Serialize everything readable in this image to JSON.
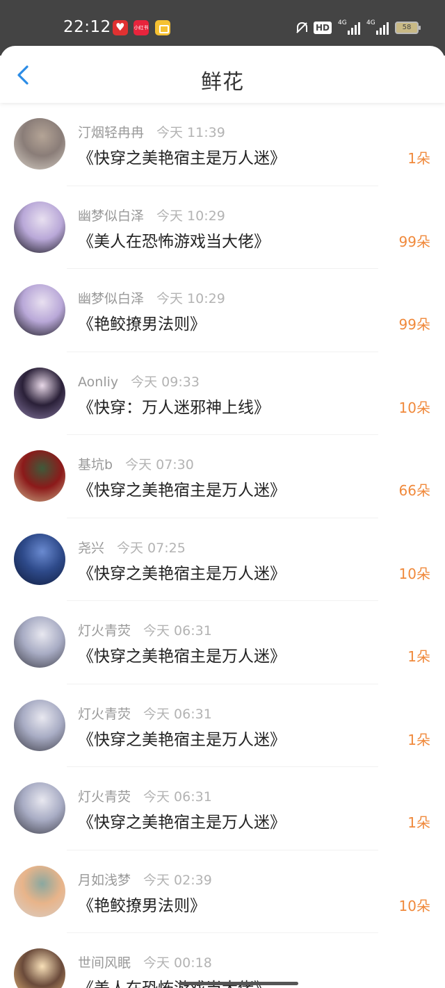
{
  "status_bar": {
    "time": "22:12",
    "app_icons": [
      "heart-app-icon",
      "xiaohongshu-icon",
      "coupon-app-icon"
    ],
    "xhs_label": "小红书",
    "hd_label": "HD",
    "network_labels": [
      "4G",
      "4G"
    ],
    "battery_level": "58"
  },
  "header": {
    "back_icon": "chevron-left-icon",
    "title": "鲜花",
    "accent_color": "#2b8ce6"
  },
  "colors": {
    "count": "#f0893b",
    "name": "#999999",
    "title": "#222222"
  },
  "flowers": [
    {
      "name": "汀烟轻冉冉",
      "time": "今天 11:39",
      "book": "《快穿之美艳宿主是万人迷》",
      "count": "1朵",
      "avatar_colors": [
        "#d9d2c8",
        "#8a7d78",
        "#b4a496"
      ]
    },
    {
      "name": "幽梦似白泽",
      "time": "今天 10:29",
      "book": "《美人在恐怖游戏当大佬》",
      "count": "99朵",
      "avatar_colors": [
        "#0f0f14",
        "#b9a8d8",
        "#e8e0f0"
      ]
    },
    {
      "name": "幽梦似白泽",
      "time": "今天 10:29",
      "book": "《艳鲛撩男法则》",
      "count": "99朵",
      "avatar_colors": [
        "#0f0f14",
        "#b9a8d8",
        "#e8e0f0"
      ]
    },
    {
      "name": "Aonliy",
      "time": "今天 09:33",
      "book": "《快穿：万人迷邪神上线》",
      "count": "10朵",
      "avatar_colors": [
        "#8d7fa8",
        "#2a2038",
        "#e8d8e8"
      ]
    },
    {
      "name": "基坑b",
      "time": "今天 07:30",
      "book": "《快穿之美艳宿主是万人迷》",
      "count": "66朵",
      "avatar_colors": [
        "#cdb48c",
        "#8c1a1a",
        "#3e5a3a"
      ]
    },
    {
      "name": "尧兴",
      "time": "今天 07:25",
      "book": "《快穿之美艳宿主是万人迷》",
      "count": "10朵",
      "avatar_colors": [
        "#0e1a3a",
        "#2e4a8a",
        "#6a8ad0"
      ]
    },
    {
      "name": "灯火青荧",
      "time": "今天 06:31",
      "book": "《快穿之美艳宿主是万人迷》",
      "count": "1朵",
      "avatar_colors": [
        "#3a3a44",
        "#a8acc4",
        "#e8e8f0"
      ]
    },
    {
      "name": "灯火青荧",
      "time": "今天 06:31",
      "book": "《快穿之美艳宿主是万人迷》",
      "count": "1朵",
      "avatar_colors": [
        "#3a3a44",
        "#a8acc4",
        "#e8e8f0"
      ]
    },
    {
      "name": "灯火青荧",
      "time": "今天 06:31",
      "book": "《快穿之美艳宿主是万人迷》",
      "count": "1朵",
      "avatar_colors": [
        "#3a3a44",
        "#a8acc4",
        "#e8e8f0"
      ]
    },
    {
      "name": "月如浅梦",
      "time": "今天 02:39",
      "book": "《艳鲛撩男法则》",
      "count": "10朵",
      "avatar_colors": [
        "#d8cfc8",
        "#e8b48a",
        "#8aa8a0"
      ]
    },
    {
      "name": "世间风眠",
      "time": "今天 00:18",
      "book": "《美人在恐怖游戏当大佬》",
      "count": "",
      "avatar_colors": [
        "#f0c080",
        "#6a4a3a",
        "#f8e0b8"
      ]
    }
  ]
}
